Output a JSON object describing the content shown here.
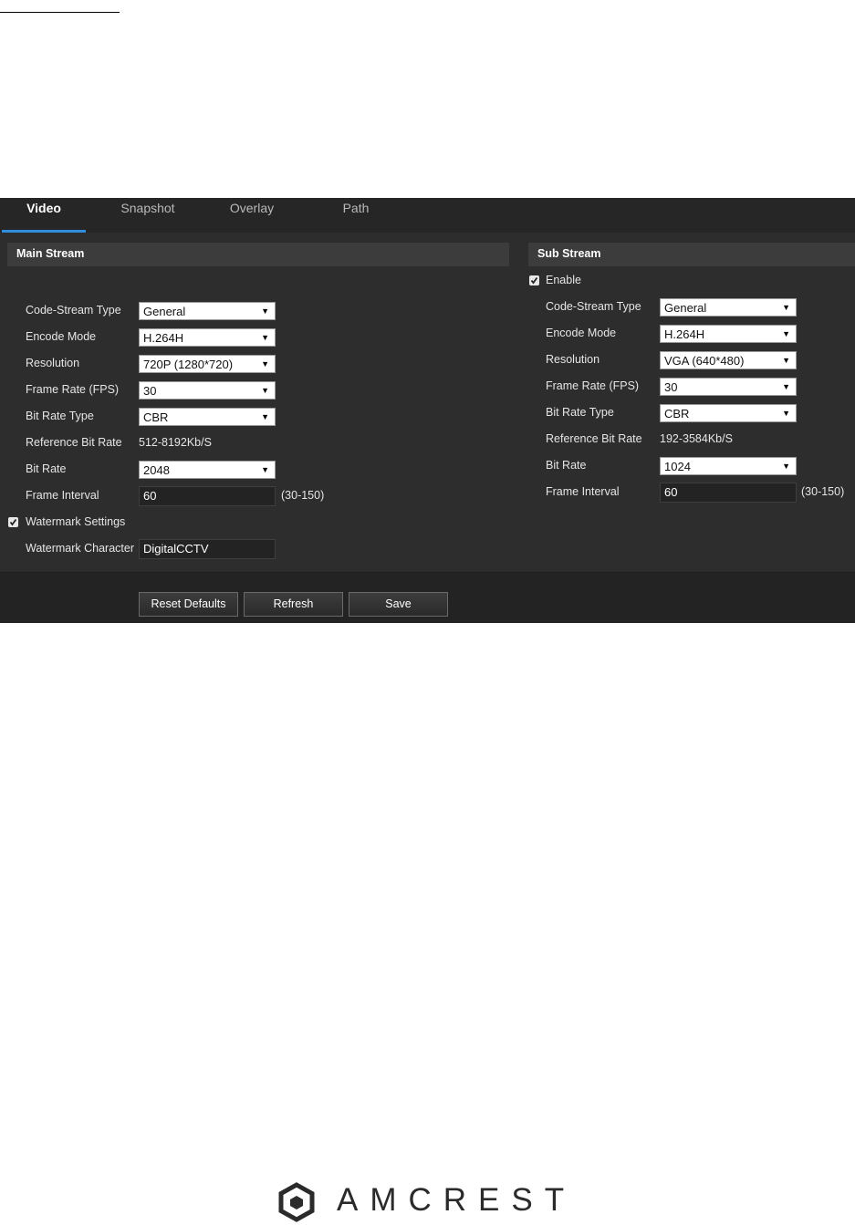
{
  "tabs": [
    "Video",
    "Snapshot",
    "Overlay",
    "Path"
  ],
  "main_stream": {
    "header": "Main Stream",
    "code_stream_type": {
      "label": "Code-Stream Type",
      "value": "General"
    },
    "encode_mode": {
      "label": "Encode Mode",
      "value": "H.264H"
    },
    "resolution": {
      "label": "Resolution",
      "value": "720P (1280*720)"
    },
    "frame_rate": {
      "label": "Frame Rate (FPS)",
      "value": "30"
    },
    "bit_rate_type": {
      "label": "Bit Rate Type",
      "value": "CBR"
    },
    "reference_bit_rate": {
      "label": "Reference Bit Rate",
      "value": "512-8192Kb/S"
    },
    "bit_rate": {
      "label": "Bit Rate",
      "value": "2048"
    },
    "frame_interval": {
      "label": "Frame Interval",
      "value": "60",
      "range": "(30-150)"
    },
    "watermark_settings": {
      "label": "Watermark Settings",
      "checked": true
    },
    "watermark_character": {
      "label": "Watermark Character",
      "value": "DigitalCCTV"
    }
  },
  "sub_stream": {
    "header": "Sub Stream",
    "enable": {
      "label": "Enable",
      "checked": true
    },
    "code_stream_type": {
      "label": "Code-Stream Type",
      "value": "General"
    },
    "encode_mode": {
      "label": "Encode Mode",
      "value": "H.264H"
    },
    "resolution": {
      "label": "Resolution",
      "value": "VGA (640*480)"
    },
    "frame_rate": {
      "label": "Frame Rate (FPS)",
      "value": "30"
    },
    "bit_rate_type": {
      "label": "Bit Rate Type",
      "value": "CBR"
    },
    "reference_bit_rate": {
      "label": "Reference Bit Rate",
      "value": "192-3584Kb/S"
    },
    "bit_rate": {
      "label": "Bit Rate",
      "value": "1024"
    },
    "frame_interval": {
      "label": "Frame Interval",
      "value": "60",
      "range": "(30-150)"
    }
  },
  "buttons": {
    "reset_defaults": "Reset Defaults",
    "refresh": "Refresh",
    "save": "Save"
  },
  "dropdown_caret": "▼",
  "logo_text": "AMCREST",
  "colors": {
    "accent": "#2f8fdc",
    "panel_bg": "#2d2d2d",
    "header_bg": "#3c3c3c"
  }
}
